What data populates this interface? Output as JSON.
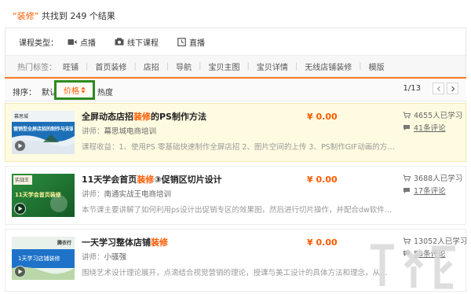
{
  "search": {
    "keyword": "“装修”",
    "summary": "共找到 249 个结果"
  },
  "filters": {
    "type_label": "课程类型：",
    "types": [
      {
        "label": "点播",
        "icon": "video-camera-icon"
      },
      {
        "label": "线下课程",
        "icon": "offline-course-icon"
      },
      {
        "label": "直播",
        "icon": "live-clock-icon"
      }
    ],
    "tags_label": "热门标签：",
    "tags": [
      "旺铺",
      "首页装修",
      "店招",
      "导航",
      "宝贝主图",
      "宝贝详情",
      "无线店铺装修",
      "模版"
    ]
  },
  "sort": {
    "label": "排序：",
    "default": "默认",
    "price": "价格",
    "heat": "热度",
    "page": "1/13"
  },
  "courses": [
    {
      "title_pre": "全屏动态店招",
      "title_kw": "装修",
      "title_post": "的PS制作方法",
      "teacher_label": "讲师：",
      "teacher": "幕思城电商培训",
      "desc": "课程收益：1、使用PS 零基础快速制作全屏店招 2、图片空间的上传 3、PS制作GIF动画的方…",
      "price": "¥ 0.00",
      "learners": "4655人已学习",
      "reviews": "41条评论",
      "thumb_text": "营销型全屏店招的制作与安装",
      "thumb_brand": "幕思城"
    },
    {
      "title_pre": "11天学会首页",
      "title_kw": "装修",
      "title_post": "③促销区切片设计",
      "teacher_label": "讲师：",
      "teacher": "南通实战王电商培训",
      "desc": "本节课主要讲解了如何利用ps设计出促销专区的效果图，然后进行切片操作，并配合dw软件…",
      "price": "¥ 0.00",
      "learners": "3688人已学习",
      "reviews": "17条评论",
      "thumb_text": "11天学会首页装修",
      "thumb_brand": "实战王"
    },
    {
      "title_pre": "一天学习整体店铺",
      "title_kw": "装修",
      "title_post": "",
      "teacher_label": "讲师：",
      "teacher": "小骚强",
      "desc": "围绕艺术设计理论展开，点滴结合视觉营销的理论，授课与美工设计的具体方法和理念，从…",
      "price": "¥ 0.00",
      "learners": "13052人已学习",
      "reviews": "58条评论",
      "thumb_text": "1天学习店铺装修",
      "thumb_brand": "腾衣行"
    }
  ],
  "colors": {
    "accent": "#ff5a00",
    "sort_border": "#ff7b22",
    "highlight_box": "#2e8b1e",
    "row_highlight": "#fffbe1"
  }
}
